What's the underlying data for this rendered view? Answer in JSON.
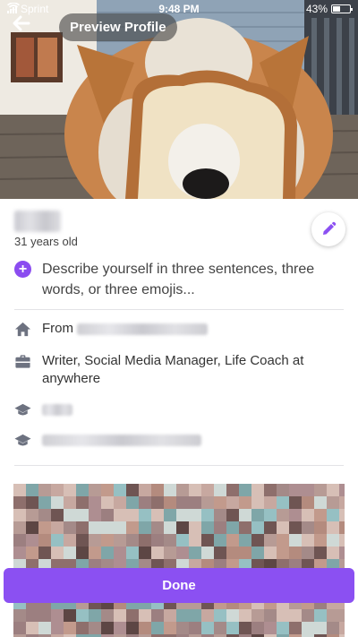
{
  "status_bar": {
    "carrier": "Sprint",
    "time": "9:48 PM",
    "battery_percent": "43%",
    "battery_level": 0.43,
    "icons": [
      "signal-icon",
      "wifi-icon",
      "battery-icon"
    ]
  },
  "header": {
    "title": "Preview Profile",
    "back_icon": "arrow-left-icon"
  },
  "profile": {
    "age": "31 years old",
    "prompt": "Describe yourself in three sentences, three words, or three emojis...",
    "hometown_label": "From",
    "occupation": "Writer, Social Media Manager, Life Coach at anywhere"
  },
  "footer": {
    "done_label": "Done"
  },
  "colors": {
    "accent": "#8b50f2",
    "icon_gray": "#6d7280"
  }
}
